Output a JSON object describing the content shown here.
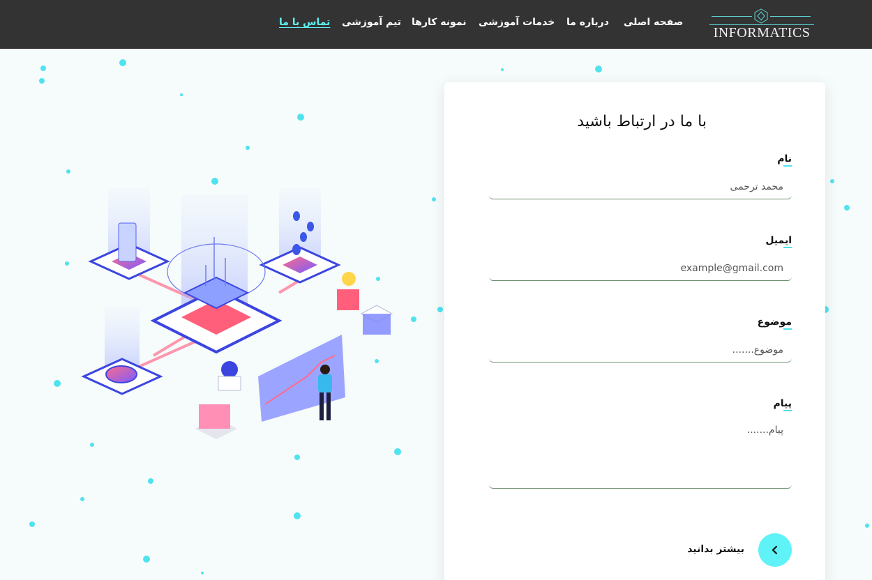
{
  "brand": {
    "logo_text": "INFORMATICS"
  },
  "nav": {
    "items": [
      {
        "label": "صفحه اصلی",
        "active": false
      },
      {
        "label": "درباره ما",
        "active": false
      },
      {
        "label": "خدمات آموزشی",
        "active": false
      },
      {
        "label": "نمونه کارها",
        "active": false
      },
      {
        "label": "تیم آموزشی",
        "active": false
      },
      {
        "label": "تماس با ما",
        "active": true
      }
    ]
  },
  "contact_form": {
    "title": "با ما در ارتباط باشید",
    "fields": {
      "name": {
        "label": "نام",
        "placeholder": "محمد ترحمی"
      },
      "email": {
        "label": "ایمیل",
        "placeholder": "example@gmail.com"
      },
      "subject": {
        "label": "موضوع",
        "placeholder": "موضوع......."
      },
      "message": {
        "label": "پیام",
        "placeholder": "پیام......."
      }
    },
    "learn_more_label": "بیشتر بدانید"
  },
  "colors": {
    "header_bg": "#333333",
    "accent": "#5ff2f7",
    "page_bg": "#f6fbfb"
  }
}
